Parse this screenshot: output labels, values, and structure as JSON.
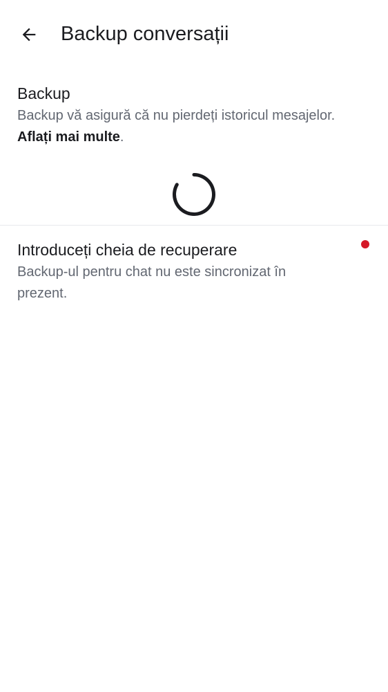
{
  "header": {
    "title": "Backup conversații"
  },
  "backup": {
    "title": "Backup",
    "description": "Backup vă asigură că nu pierdeți istoricul mesajelor. ",
    "learn_more": "Aflați mai multe",
    "trailing": "."
  },
  "recovery": {
    "title": "Introduceți cheia de recuperare",
    "description": "Backup-ul pentru chat nu este sincronizat în prezent."
  },
  "colors": {
    "accent_dot": "#d51928",
    "spinner": "#1b1c20"
  },
  "icons": {
    "back": "arrow-left-icon",
    "loading": "loading-spinner-icon"
  }
}
